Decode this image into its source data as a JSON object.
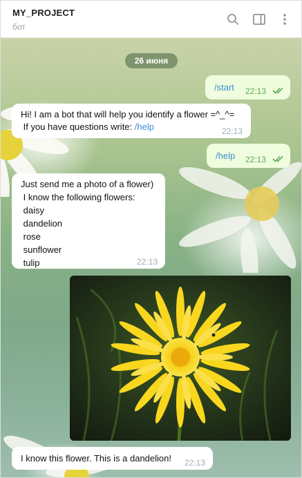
{
  "header": {
    "title": "MY_PROJECT",
    "subtitle": "бот",
    "icons": [
      "search-icon",
      "sidebar-panel-icon",
      "more-vertical-icon"
    ]
  },
  "chat": {
    "date_label": "26 июня",
    "messages": [
      {
        "side": "out",
        "text": "/start",
        "time": "22:13",
        "status": "read"
      },
      {
        "side": "in",
        "lines": [
          "Hi! I am a bot that will help you identify a flower =^_^=",
          " If you have questions write: "
        ],
        "link": "/help",
        "time": "22:13"
      },
      {
        "side": "out",
        "text": "/help",
        "time": "22:13",
        "status": "read"
      },
      {
        "side": "in",
        "lines": [
          "Just send me a photo of a flower)",
          " I know the following flowers:",
          " daisy",
          " dandelion",
          " rose",
          " sunflower",
          " tulip"
        ],
        "time": "22:13"
      },
      {
        "side": "out",
        "type": "photo",
        "subject": "dandelion"
      },
      {
        "side": "in",
        "text": "I know this flower. This is a dandelion!",
        "time": "22:13"
      }
    ]
  },
  "colors": {
    "outgoing_bubble": "#effdde",
    "incoming_bubble": "#ffffff",
    "link": "#3c8cd0",
    "read_check": "#5fa855",
    "date_pill": "#67805a"
  }
}
